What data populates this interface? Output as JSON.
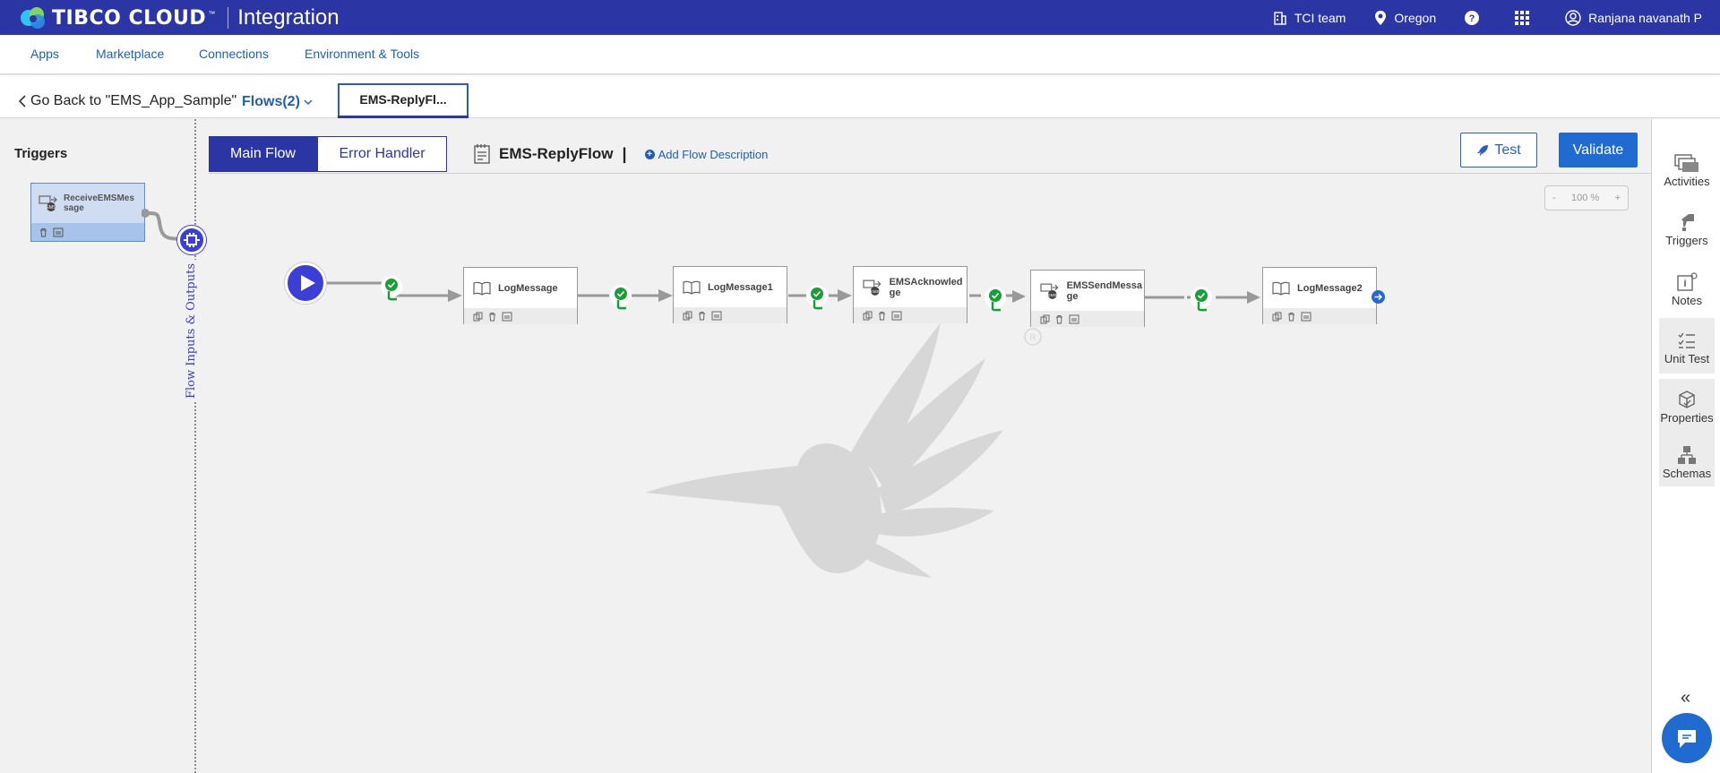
{
  "topbar": {
    "brand": "TIBCO CLOUD",
    "trademark": "™",
    "product": "Integration",
    "team": "TCI team",
    "region": "Oregon",
    "help": "?",
    "user": "Ranjana navanath P"
  },
  "nav": {
    "items": [
      "Apps",
      "Marketplace",
      "Connections",
      "Environment & Tools"
    ]
  },
  "flowbar": {
    "back": "Go Back to \"EMS_App_Sample\"",
    "flows": "Flows(2)",
    "active_tab": "EMS-ReplyFl..."
  },
  "triggers": {
    "title": "Triggers",
    "card_name": "ReceiveEMSMessage",
    "flow_io_label": "Flow Inputs & Outputs"
  },
  "editor": {
    "tabs": [
      "Main Flow",
      "Error Handler"
    ],
    "flow_name": "EMS-ReplyFlow",
    "cursor": "|",
    "add_description": "Add Flow Description",
    "test_label": "Test",
    "validate_label": "Validate",
    "zoom_minus": "-",
    "zoom_level": "100 %",
    "zoom_plus": "+"
  },
  "activities": [
    {
      "name": "LogMessage",
      "type": "log"
    },
    {
      "name": "LogMessage1",
      "type": "log"
    },
    {
      "name": "EMSAcknowledge",
      "type": "ems"
    },
    {
      "name": "EMSSendMessage",
      "type": "ems"
    },
    {
      "name": "LogMessage2",
      "type": "log"
    }
  ],
  "sidebar": {
    "items": [
      "Activities",
      "Triggers",
      "Notes",
      "Unit Test",
      "Properties",
      "Schemas"
    ],
    "collapse": "«"
  },
  "colors": {
    "header": "#2b36a4",
    "accent": "#1f6bd1",
    "link": "#1f5fb6",
    "condition": "#1a9e3a"
  }
}
